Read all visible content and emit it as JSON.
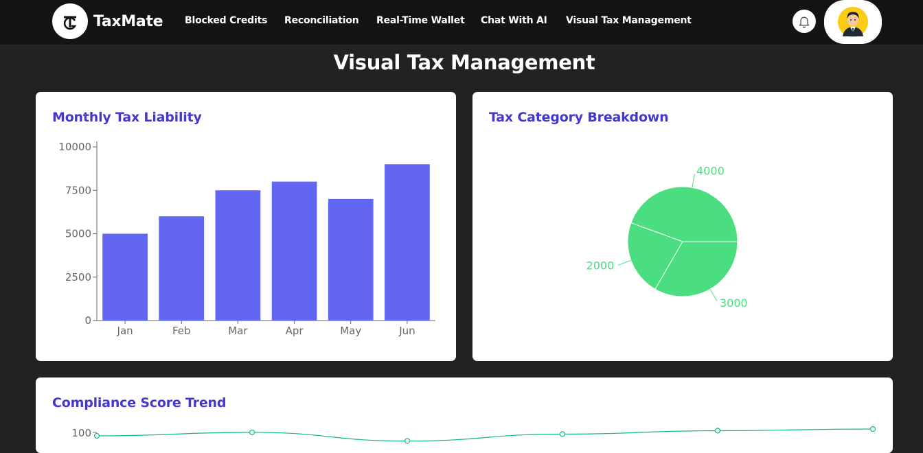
{
  "nav": {
    "brand": "TaxMate",
    "links": [
      "Blocked Credits",
      "Reconciliation",
      "Real-Time Wallet",
      "Chat With AI",
      "Visual Tax Management"
    ]
  },
  "page": {
    "title": "Visual Tax Management"
  },
  "cards": {
    "monthly": {
      "title": "Monthly Tax Liability"
    },
    "category": {
      "title": "Tax Category Breakdown"
    },
    "compliance": {
      "title": "Compliance Score Trend"
    }
  },
  "colors": {
    "bar": "#6366f1",
    "pie": "#4ade80",
    "line": "#10b981",
    "title": "#4338ca"
  },
  "chart_data": [
    {
      "type": "bar",
      "title": "Monthly Tax Liability",
      "categories": [
        "Jan",
        "Feb",
        "Mar",
        "Apr",
        "May",
        "Jun"
      ],
      "values": [
        5000,
        6000,
        7500,
        8000,
        7000,
        9000
      ],
      "yticks": [
        "0",
        "2500",
        "5000",
        "7500",
        "10000"
      ],
      "ylim": [
        0,
        10000
      ]
    },
    {
      "type": "pie",
      "title": "Tax Category Breakdown",
      "values": [
        4000,
        2000,
        3000
      ],
      "labels": [
        "4000",
        "2000",
        "3000"
      ]
    },
    {
      "type": "line",
      "title": "Compliance Score Trend",
      "values": [
        98,
        100,
        95,
        99,
        101,
        102
      ],
      "yticks": [
        "100"
      ]
    }
  ]
}
